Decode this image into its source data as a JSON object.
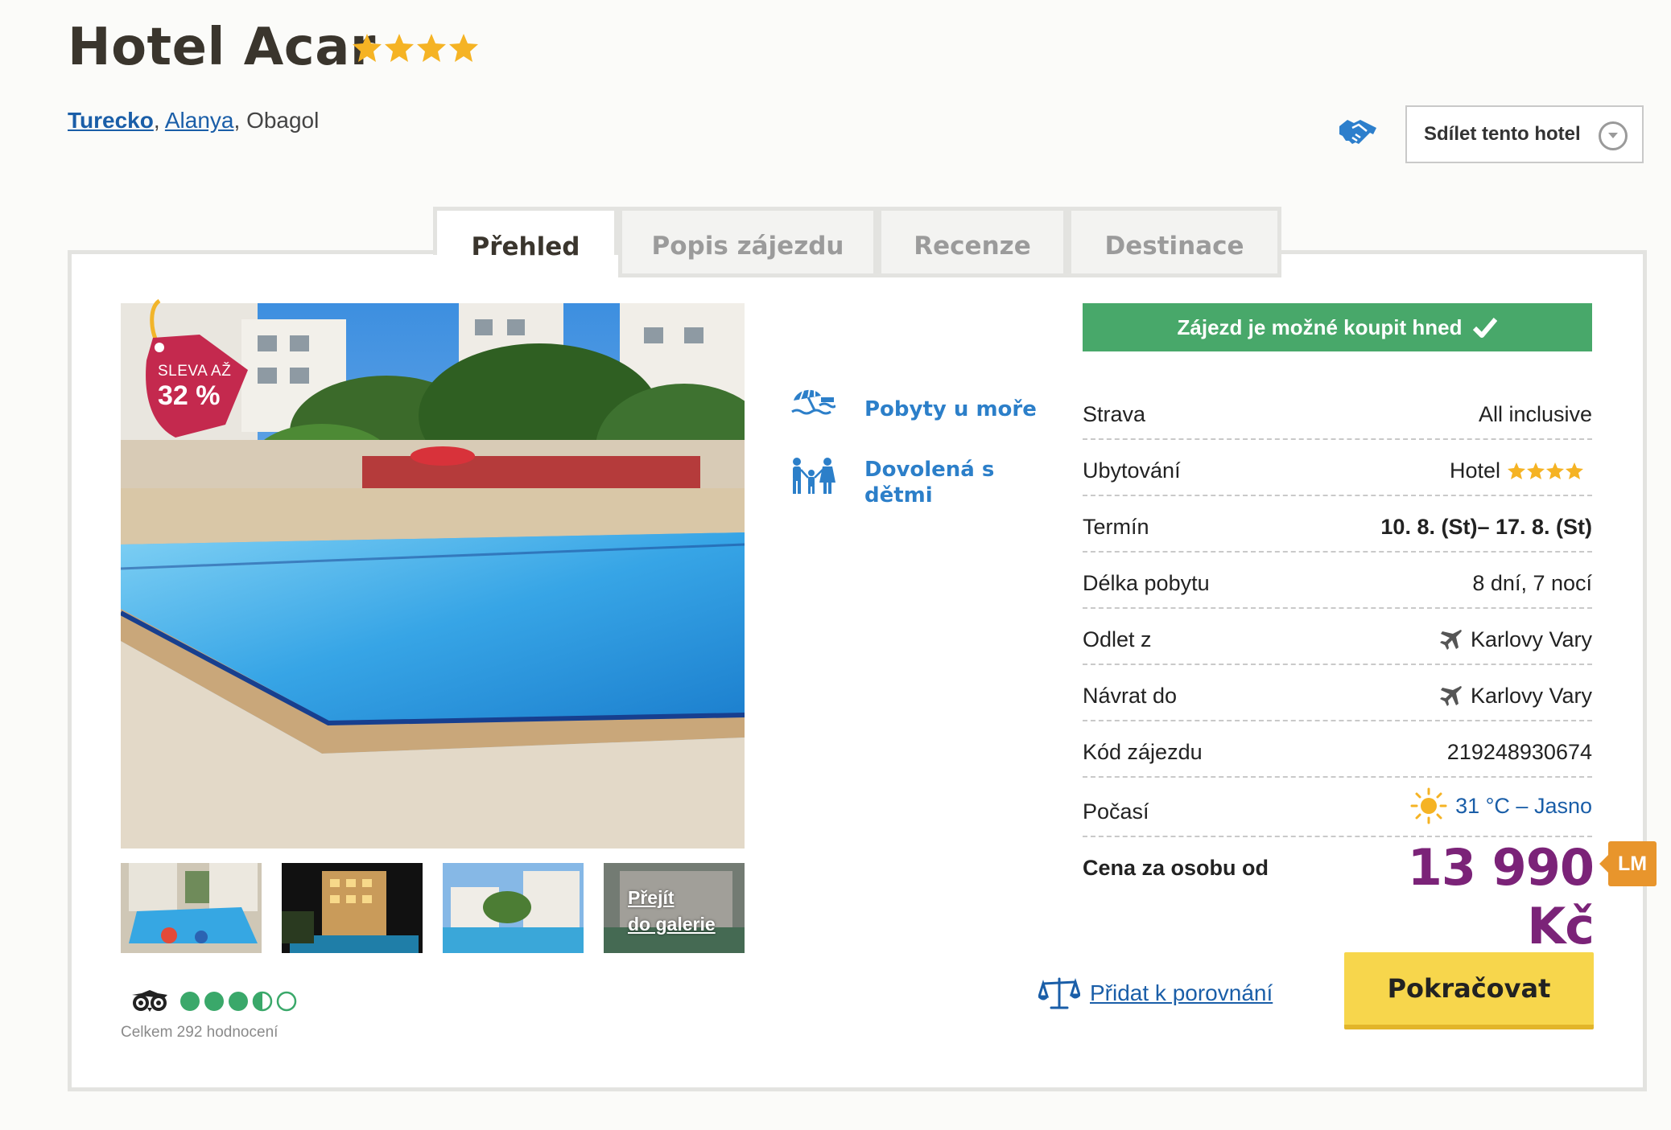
{
  "hotel": {
    "name": "Hotel Acar",
    "stars": 4
  },
  "breadcrumb": {
    "country": "Turecko",
    "city": "Alanya",
    "area": "Obagol"
  },
  "share": {
    "label": "Sdílet tento hotel",
    "icon": "handshake-icon"
  },
  "tabs": [
    {
      "label": "Přehled",
      "active": true
    },
    {
      "label": "Popis zájezdu",
      "active": false
    },
    {
      "label": "Recenze",
      "active": false
    },
    {
      "label": "Destinace",
      "active": false
    }
  ],
  "discount": {
    "line1": "SLEVA AŽ",
    "line2": "32 %"
  },
  "gallery": {
    "link_line1": "Přejít",
    "link_line2": "do galerie"
  },
  "reviews": {
    "bubbles_filled": 3.5,
    "bubbles_total": 5,
    "count_text": "Celkem 292 hodnocení"
  },
  "categories": [
    {
      "label": "Pobyty u moře",
      "icon": "beach-umbrella-icon"
    },
    {
      "label": "Dovolená s dětmi",
      "icon": "family-icon"
    }
  ],
  "buy_now": {
    "label": "Zájezd je možné koupit hned",
    "icon": "checkmark-icon"
  },
  "info": {
    "board_label": "Strava",
    "board_value": "All inclusive",
    "accommodation_label": "Ubytování",
    "accommodation_value": "Hotel",
    "term_label": "Termín",
    "term_value": "10. 8. (St)– 17. 8. (St)",
    "length_label": "Délka pobytu",
    "length_value": "8 dní, 7 nocí",
    "departure_label": "Odlet z",
    "departure_value": "Karlovy Vary",
    "return_label": "Návrat do",
    "return_value": "Karlovy Vary",
    "code_label": "Kód zájezdu",
    "code_value": "219248930674",
    "weather_label": "Počasí",
    "weather_value": "31 °C – Jasno"
  },
  "price": {
    "label": "Cena za osobu od",
    "value": "13 990 Kč",
    "badge": "LM"
  },
  "actions": {
    "compare_label": "Přidat k porovnání",
    "continue_label": "Pokračovat"
  },
  "colors": {
    "price": "#7b2378",
    "buy_now_bg": "#48a86a",
    "continue_bg": "#f7d64c",
    "link": "#1a5ea8",
    "category": "#2c7fc9",
    "lm_badge": "#e8952c"
  }
}
